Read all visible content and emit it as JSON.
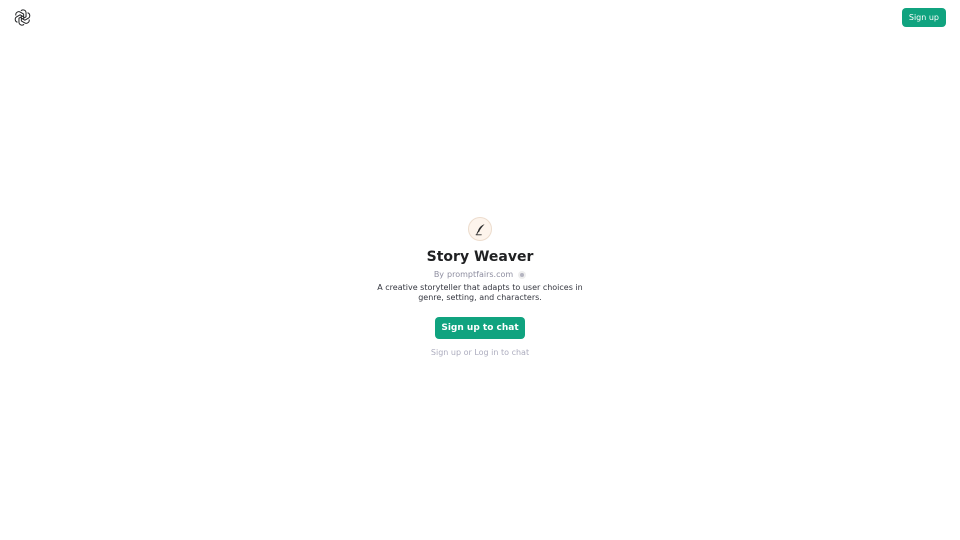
{
  "header": {
    "logo_icon": "openai-logo-icon",
    "signup_label": "Sign up"
  },
  "gpt": {
    "avatar_icon": "quill-pen-icon",
    "name": "Story Weaver",
    "by_prefix": "By",
    "author": "promptfairs.com",
    "info_icon": "info-icon",
    "description": "A creative storyteller that adapts to user choices in genre, setting, and characters."
  },
  "actions": {
    "chat_button_label": "Sign up to chat",
    "signup_link": "Sign up",
    "or_text": "or",
    "login_link": "Log in",
    "to_chat_text": "to chat"
  },
  "colors": {
    "accent": "#10a37f",
    "text": "#202123",
    "muted": "#8e8ea0"
  }
}
